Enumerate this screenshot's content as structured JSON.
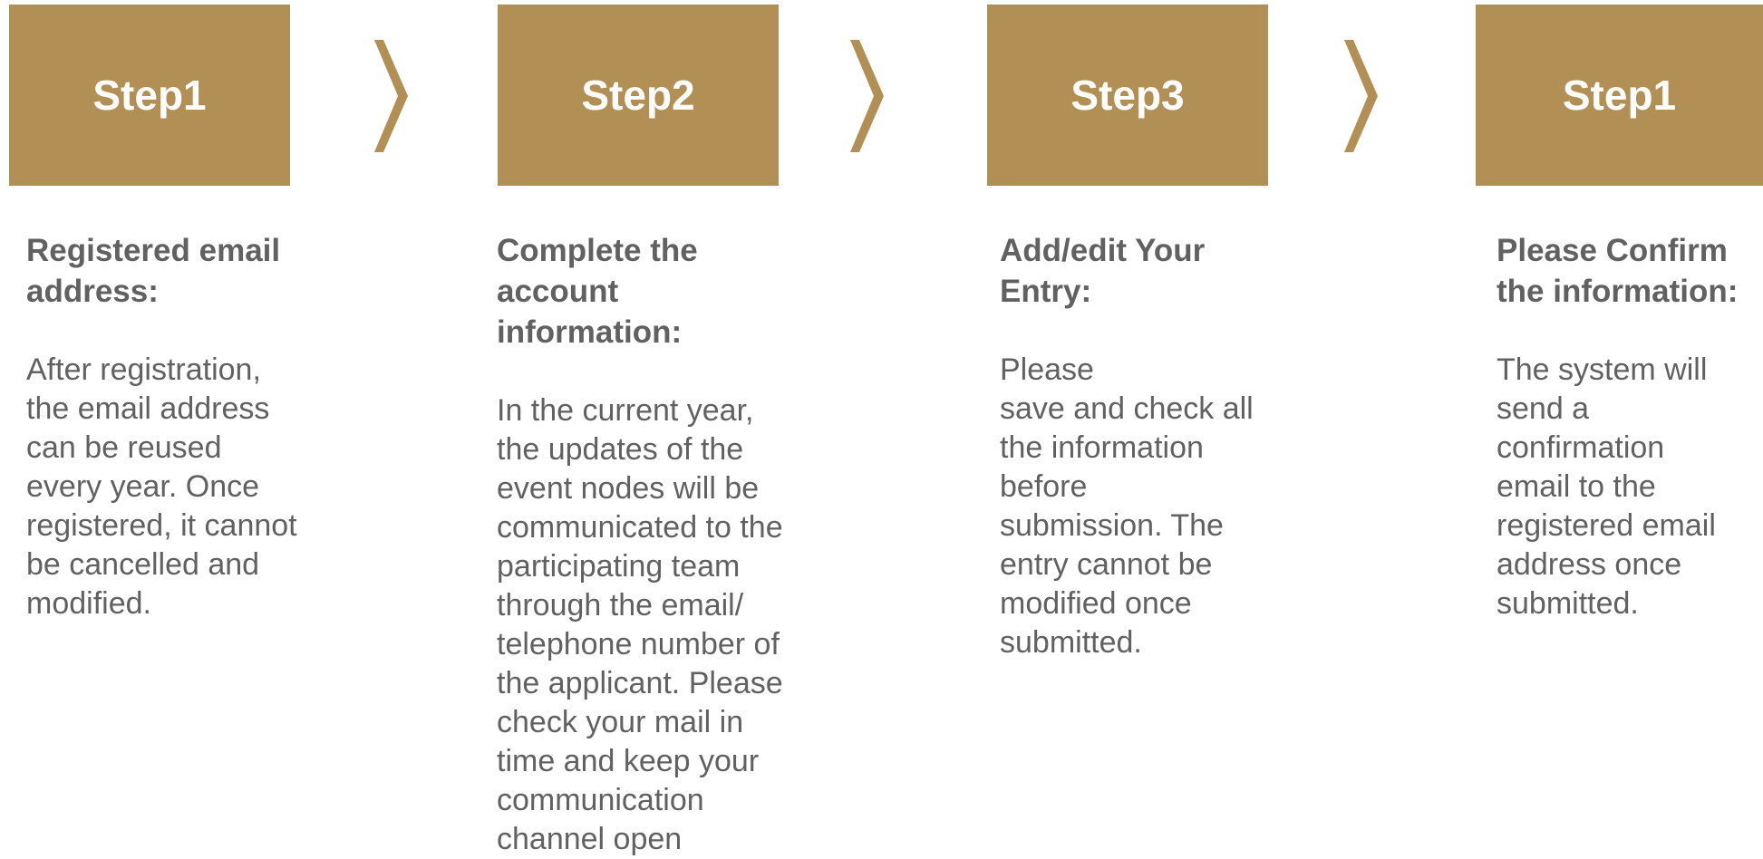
{
  "colors": {
    "accent": "#b28f54",
    "text": "#616161",
    "background": "#ffffff"
  },
  "steps": [
    {
      "label": "Step1",
      "title": "Registered email\naddress:",
      "body": "After registration,\nthe email address\ncan be reused\nevery year. Once\nregistered, it cannot\nbe cancelled and\nmodified."
    },
    {
      "label": "Step2",
      "title": "Complete the\naccount\ninformation:",
      "body": "In the current year,\nthe updates of the\nevent nodes will be\ncommunicated to the\nparticipating team\nthrough the email/\ntelephone number of\nthe applicant. Please\ncheck your mail in\ntime and keep your\ncommunication\nchannel open"
    },
    {
      "label": "Step3",
      "title": "Add/edit Your\nEntry:",
      "body": "Please\nsave and check all\nthe information\nbefore\nsubmission. The\nentry cannot be\nmodified once\nsubmitted."
    },
    {
      "label": "Step1",
      "title": "Please Confirm\nthe information:",
      "body": "The system will\nsend a\nconfirmation\nemail to the\nregistered email\naddress once\nsubmitted."
    }
  ],
  "connectors": [
    {
      "icon": "chevron-right-icon"
    },
    {
      "icon": "chevron-right-icon"
    },
    {
      "icon": "chevron-right-icon"
    }
  ]
}
